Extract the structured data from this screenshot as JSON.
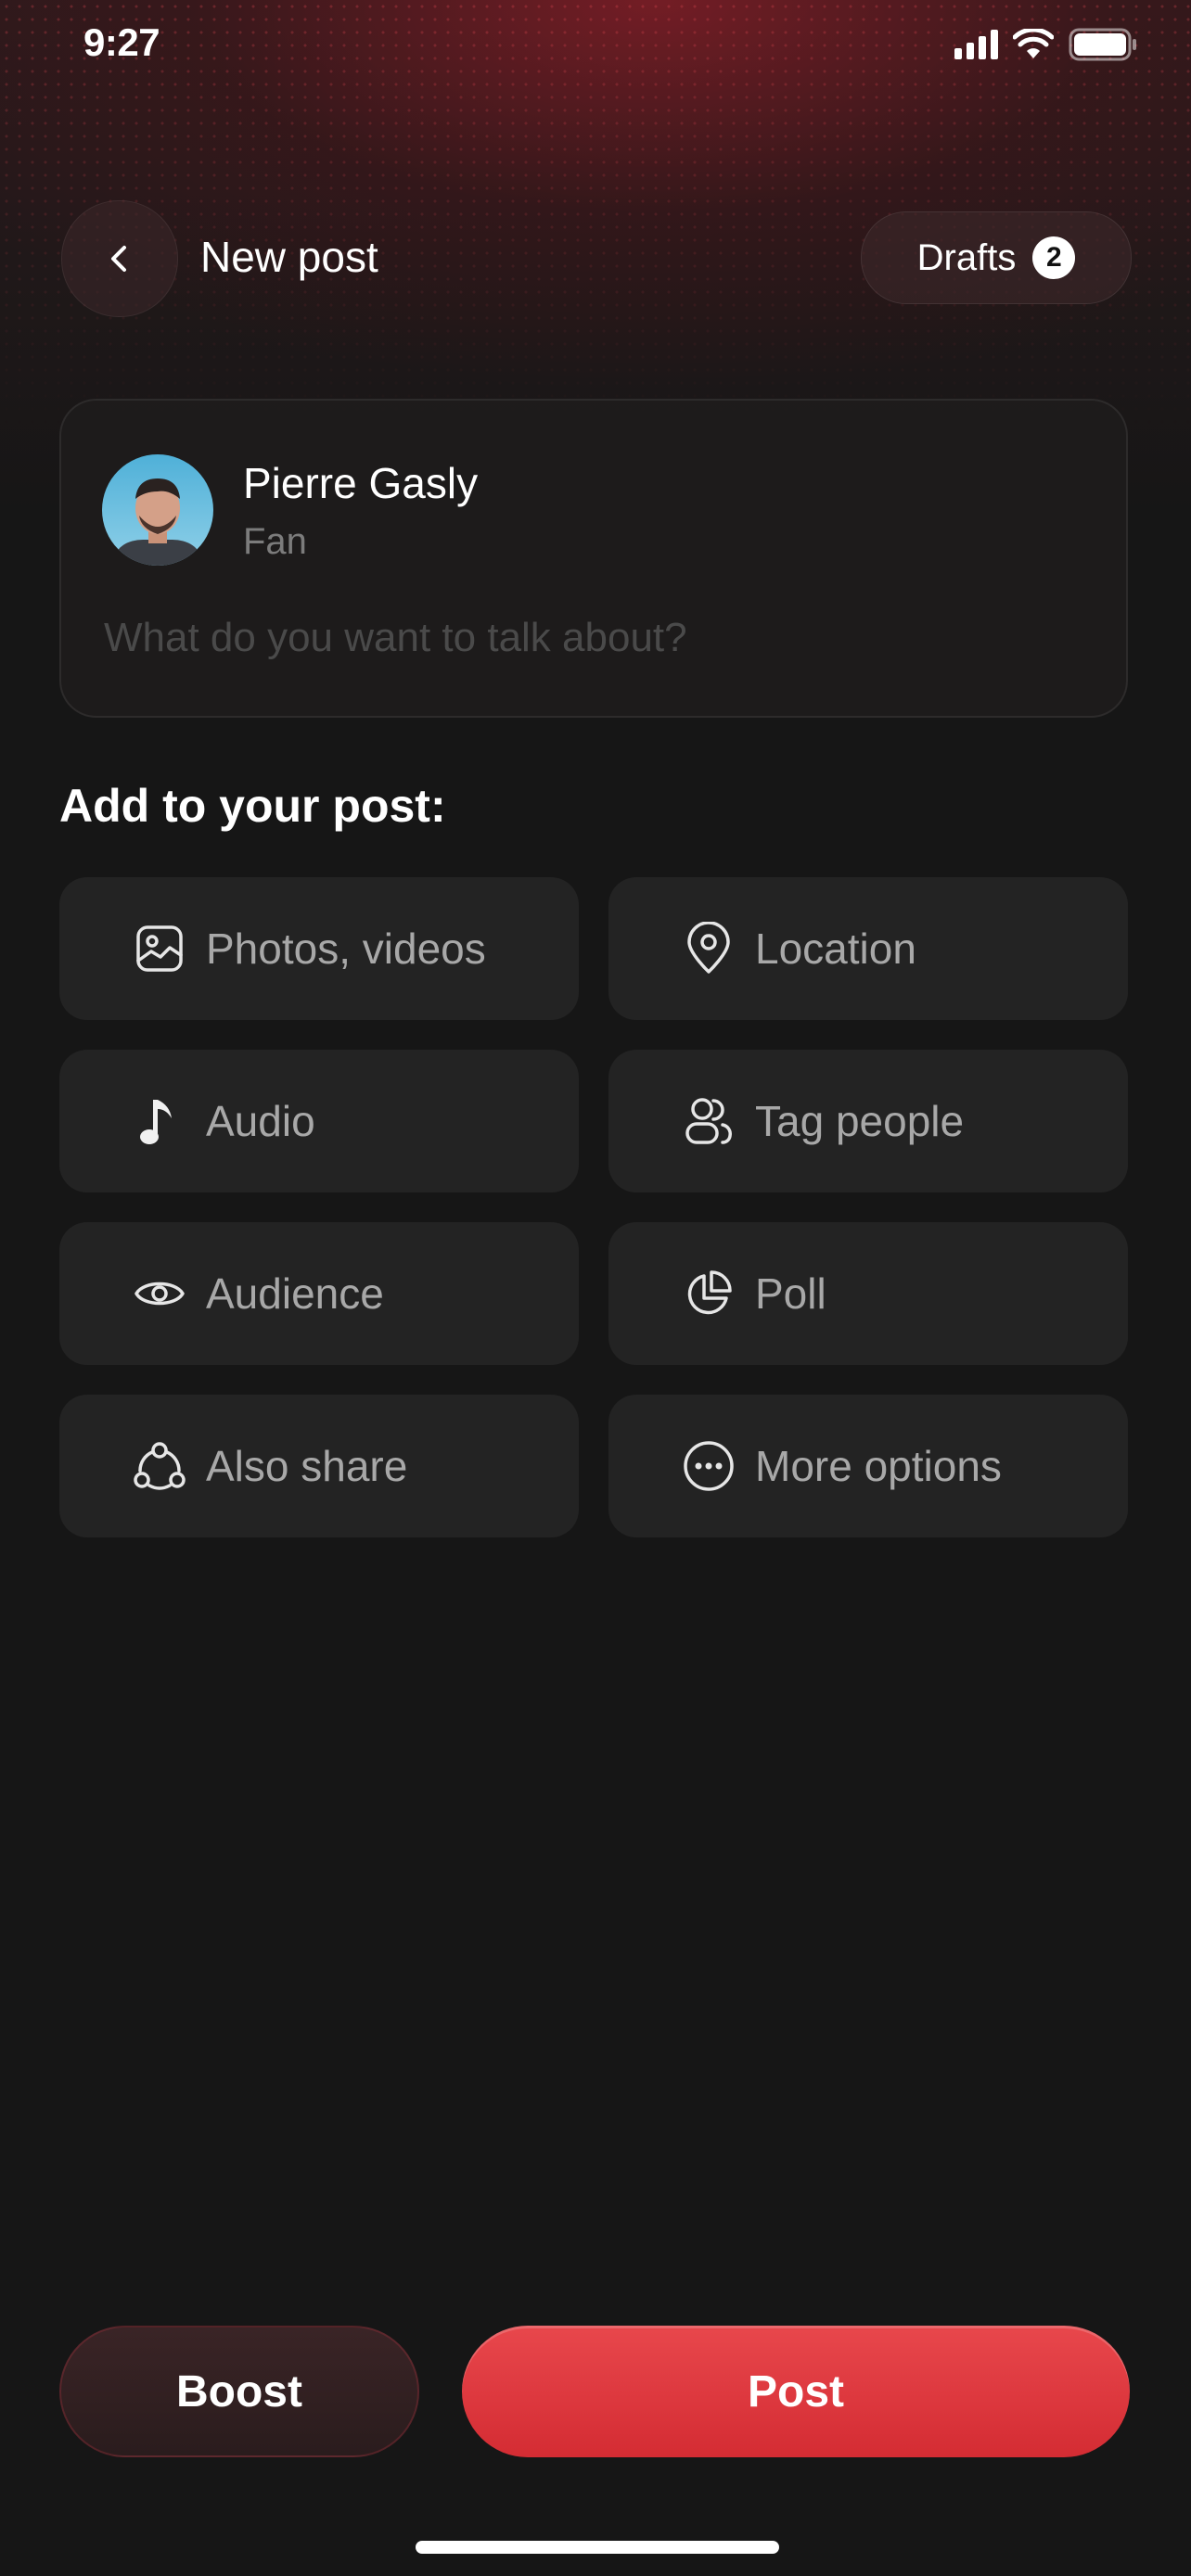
{
  "status_bar": {
    "time": "9:27"
  },
  "header": {
    "title": "New post",
    "drafts_label": "Drafts",
    "drafts_count": "2"
  },
  "composer": {
    "user_name": "Pierre Gasly",
    "user_role": "Fan",
    "placeholder": "What do you want to talk about?"
  },
  "add_section": {
    "title": "Add to your post:",
    "options": [
      {
        "label": "Photos, videos",
        "icon": "image-icon"
      },
      {
        "label": "Location",
        "icon": "location-pin-icon"
      },
      {
        "label": "Audio",
        "icon": "music-note-icon"
      },
      {
        "label": "Tag people",
        "icon": "people-icon"
      },
      {
        "label": "Audience",
        "icon": "eye-icon"
      },
      {
        "label": "Poll",
        "icon": "pie-chart-icon"
      },
      {
        "label": "Also share",
        "icon": "share-nodes-icon"
      },
      {
        "label": "More options",
        "icon": "more-dots-icon"
      }
    ]
  },
  "actions": {
    "boost_label": "Boost",
    "post_label": "Post"
  },
  "colors": {
    "accent": "#e03a40",
    "background": "#161616",
    "option_bg": "#232323"
  }
}
